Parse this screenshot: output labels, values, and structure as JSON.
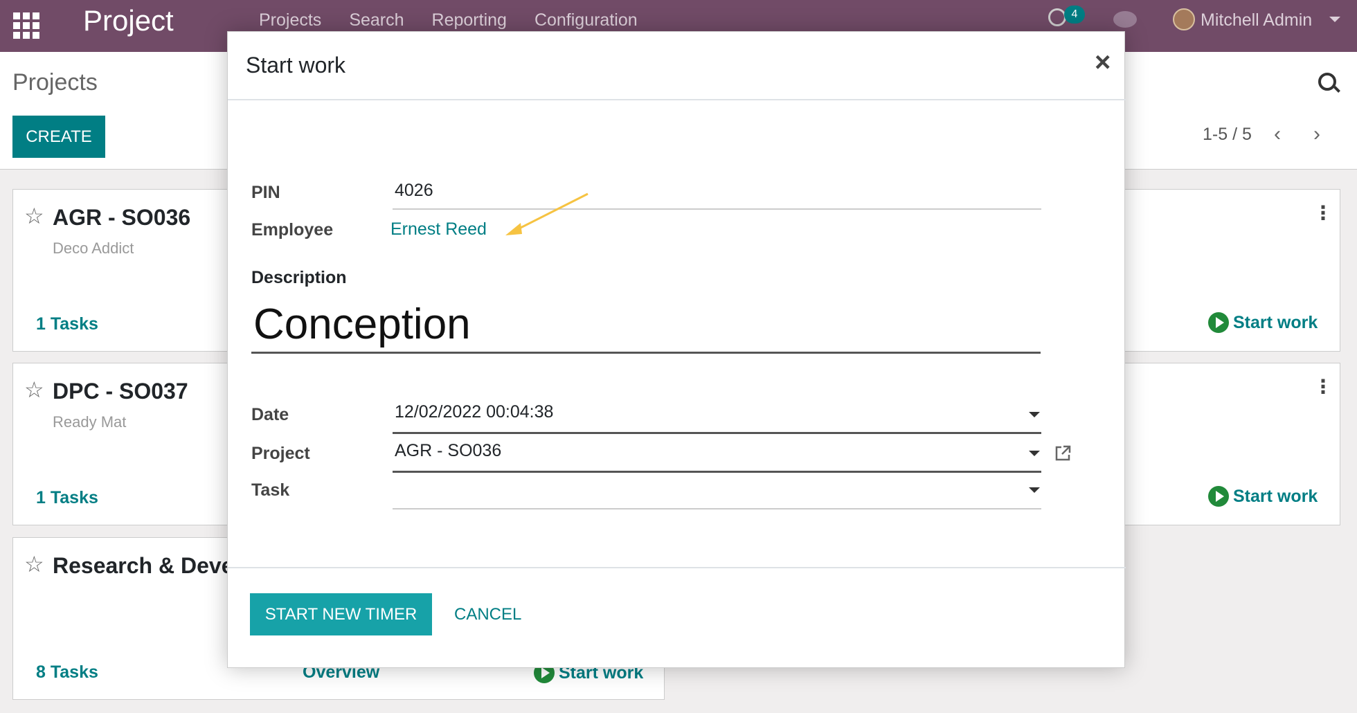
{
  "navbar": {
    "brand": "Project",
    "menu": [
      "Projects",
      "Search",
      "Reporting",
      "Configuration"
    ],
    "activity_count": "4",
    "user_name": "Mitchell Admin"
  },
  "control_panel": {
    "breadcrumb": "Projects",
    "create_label": "CREATE",
    "pager": "1-5 / 5"
  },
  "cards": [
    {
      "title": "AGR - SO036",
      "subtitle": "Deco Addict",
      "tasks": "1 Tasks",
      "start_label": "Start work"
    },
    {
      "title": "DPC - SO037",
      "subtitle": "Ready Mat",
      "tasks": "1 Tasks",
      "start_label": "Start work"
    },
    {
      "title": "Research & Development",
      "subtitle": "",
      "tasks": "8 Tasks",
      "overview": "Overview",
      "start_label": "Start work"
    }
  ],
  "modal": {
    "title": "Start work",
    "close": "×",
    "fields": {
      "pin_label": "PIN",
      "pin_value": "4026",
      "employee_label": "Employee",
      "employee_value": "Ernest Reed",
      "description_label": "Description",
      "description_value": "Conception",
      "date_label": "Date",
      "date_value": "12/02/2022 00:04:38",
      "project_label": "Project",
      "project_value": "AGR - SO036",
      "task_label": "Task",
      "task_value": ""
    },
    "footer": {
      "start_label": "START NEW TIMER",
      "cancel_label": "CANCEL"
    }
  },
  "colors": {
    "navbar": "#714b67",
    "primary": "#017e84",
    "button_primary": "#17a2a8",
    "annotation_arrow": "#f6c342"
  }
}
